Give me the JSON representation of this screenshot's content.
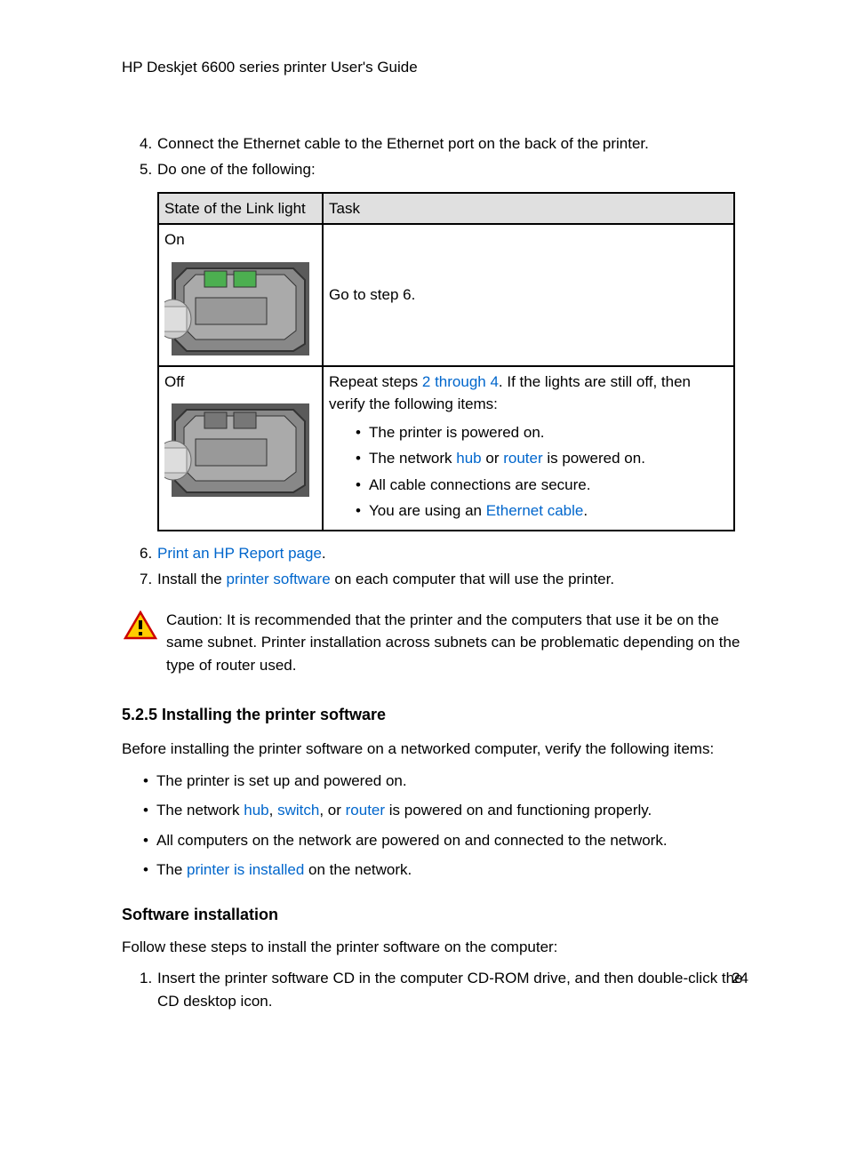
{
  "header": "HP Deskjet 6600 series printer User's Guide",
  "steps": {
    "s4": {
      "num": "4.",
      "text": "Connect the Ethernet cable to the Ethernet port on the back of the printer."
    },
    "s5": {
      "num": "5.",
      "text": "Do one of the following:"
    },
    "s6": {
      "num": "6.",
      "link": "Print an HP Report page",
      "after": "."
    },
    "s7": {
      "num": "7.",
      "before": "Install the ",
      "link": "printer software",
      "after": " on each computer that will use the printer."
    }
  },
  "table": {
    "h1": "State of the Link light",
    "h2": "Task",
    "row_on": {
      "state": "On",
      "task": "Go to step 6."
    },
    "row_off": {
      "state": "Off",
      "task_before": "Repeat steps ",
      "task_link": "2 through 4",
      "task_after": ". If the lights are still off, then verify the following items:",
      "items": {
        "i1": "The printer is powered on.",
        "i2_before": "The network ",
        "i2_link1": "hub",
        "i2_mid": " or ",
        "i2_link2": "router",
        "i2_after": " is powered on.",
        "i3": "All cable connections are secure.",
        "i4_before": "You are using an ",
        "i4_link": "Ethernet cable",
        "i4_after": "."
      }
    }
  },
  "caution": "Caution: It is recommended that the printer and the computers that use it be on the same subnet. Printer installation across subnets can be problematic depending on the type of router used.",
  "section": {
    "heading": "5.2.5  Installing the printer software",
    "intro": "Before installing the printer software on a networked computer, verify the following items:",
    "items": {
      "i1": "The printer is set up and powered on.",
      "i2_before": "The network ",
      "i2_link1": "hub",
      "i2_c1": ", ",
      "i2_link2": "switch",
      "i2_c2": ", or ",
      "i2_link3": "router",
      "i2_after": " is powered on and functioning properly.",
      "i3": "All computers on the network are powered on and connected to the network.",
      "i4_before": "The ",
      "i4_link": "printer is installed",
      "i4_after": " on the network."
    },
    "sub_heading": "Software installation",
    "sub_intro": "Follow these steps to install the printer software on the computer:",
    "install_step1_num": "1.",
    "install_step1_text": "Insert the printer software CD in the computer CD-ROM drive, and then double-click the CD desktop icon."
  },
  "page_num": "24"
}
